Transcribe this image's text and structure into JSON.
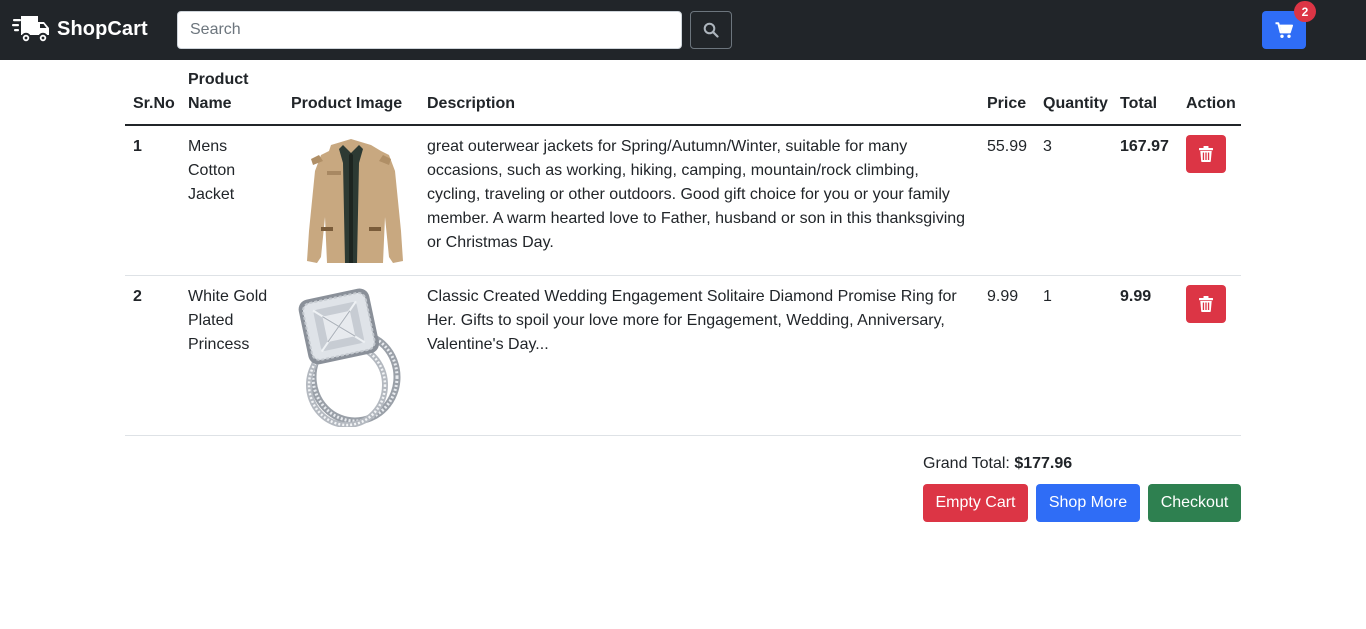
{
  "navbar": {
    "brand": "ShopCart",
    "search_placeholder": "Search",
    "search_value": "",
    "cart_count": "2",
    "bg_color": "#212529"
  },
  "table": {
    "headers": {
      "sr_no": "Sr.No",
      "product_name": "Product Name",
      "product_image": "Product Image",
      "description": "Description",
      "price": "Price",
      "quantity": "Quantity",
      "total": "Total",
      "action": "Action"
    },
    "rows": [
      {
        "sr_no": "1",
        "name": "Mens Cotton Jacket",
        "image": "jacket",
        "description": "great outerwear jackets for Spring/Autumn/Winter, suitable for many occasions, such as working, hiking, camping, mountain/rock climbing, cycling, traveling or other outdoors. Good gift choice for you or your family member. A warm hearted love to Father, husband or son in this thanksgiving or Christmas Day.",
        "price": "55.99",
        "quantity": "3",
        "total": "167.97",
        "action_icon": "trash-icon"
      },
      {
        "sr_no": "2",
        "name": "White Gold Plated Princess",
        "image": "ring",
        "description": "Classic Created Wedding Engagement Solitaire Diamond Promise Ring for Her. Gifts to spoil your love more for Engagement, Wedding, Anniversary, Valentine's Day...",
        "price": "9.99",
        "quantity": "1",
        "total": "9.99",
        "action_icon": "trash-icon"
      }
    ]
  },
  "summary": {
    "grand_total_label": "Grand Total: ",
    "grand_total_value": "$177.96",
    "empty_cart_label": "Empty Cart",
    "shop_more_label": "Shop More",
    "checkout_label": "Checkout"
  },
  "colors": {
    "danger": "#dc3545",
    "primary": "#2f6df6",
    "success": "#2e8050"
  }
}
